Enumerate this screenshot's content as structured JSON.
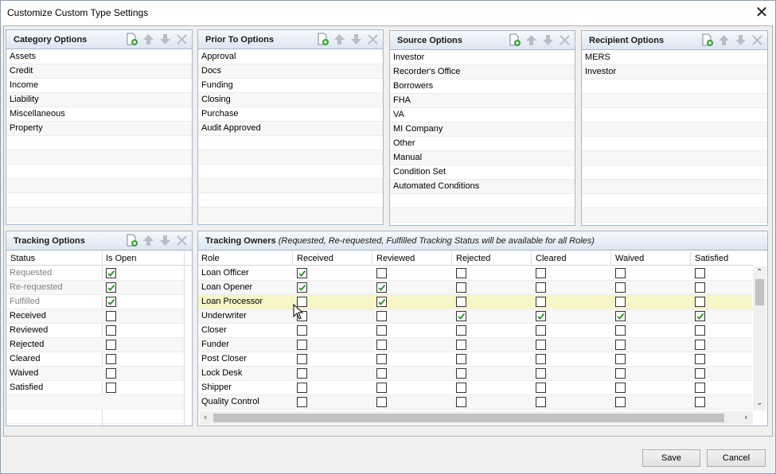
{
  "window": {
    "title": "Customize Custom Type Settings"
  },
  "category": {
    "title": "Category Options",
    "items": [
      "Assets",
      "Credit",
      "Income",
      "Liability",
      "Miscellaneous",
      "Property"
    ]
  },
  "prior_to": {
    "title": "Prior To Options",
    "items": [
      "Approval",
      "Docs",
      "Funding",
      "Closing",
      "Purchase",
      "Audit Approved"
    ]
  },
  "source": {
    "title": "Source Options",
    "items": [
      "Investor",
      "Recorder's Office",
      "Borrowers",
      "FHA",
      "VA",
      "MI Company",
      "Other",
      "Manual",
      "Condition Set",
      "Automated Conditions"
    ]
  },
  "recipient": {
    "title": "Recipient Options",
    "items": [
      "MERS",
      "Investor"
    ]
  },
  "tracking_options": {
    "title": "Tracking Options",
    "col_status": "Status",
    "col_open": "Is Open",
    "rows": [
      {
        "status": "Requested",
        "open": true,
        "muted": true
      },
      {
        "status": "Re-requested",
        "open": true,
        "muted": true
      },
      {
        "status": "Fulfilled",
        "open": true,
        "muted": true
      },
      {
        "status": "Received",
        "open": false,
        "muted": false
      },
      {
        "status": "Reviewed",
        "open": false,
        "muted": false
      },
      {
        "status": "Rejected",
        "open": false,
        "muted": false
      },
      {
        "status": "Cleared",
        "open": false,
        "muted": false
      },
      {
        "status": "Waived",
        "open": false,
        "muted": false
      },
      {
        "status": "Satisfied",
        "open": false,
        "muted": false
      }
    ]
  },
  "tracking_owners": {
    "title": "Tracking Owners",
    "subtitle": "(Requested, Re-requested, Fulfilled Tracking Status will be available for all Roles)",
    "columns": [
      "Role",
      "Received",
      "Reviewed",
      "Rejected",
      "Cleared",
      "Waived",
      "Satisfied"
    ],
    "rows": [
      {
        "role": "Loan Officer",
        "checks": [
          true,
          false,
          false,
          false,
          false,
          false
        ]
      },
      {
        "role": "Loan Opener",
        "checks": [
          true,
          true,
          false,
          false,
          false,
          false
        ]
      },
      {
        "role": "Loan Processor",
        "checks": [
          false,
          true,
          false,
          false,
          false,
          false
        ],
        "selected": true
      },
      {
        "role": "Underwriter",
        "checks": [
          false,
          false,
          true,
          true,
          true,
          true
        ]
      },
      {
        "role": "Closer",
        "checks": [
          false,
          false,
          false,
          false,
          false,
          false
        ]
      },
      {
        "role": "Funder",
        "checks": [
          false,
          false,
          false,
          false,
          false,
          false
        ]
      },
      {
        "role": "Post Closer",
        "checks": [
          false,
          false,
          false,
          false,
          false,
          false
        ]
      },
      {
        "role": "Lock Desk",
        "checks": [
          false,
          false,
          false,
          false,
          false,
          false
        ]
      },
      {
        "role": "Shipper",
        "checks": [
          false,
          false,
          false,
          false,
          false,
          false
        ]
      },
      {
        "role": "Quality Control",
        "checks": [
          false,
          false,
          false,
          false,
          false,
          false
        ]
      }
    ]
  },
  "buttons": {
    "save": "Save",
    "cancel": "Cancel"
  },
  "icons": {
    "add": "add-document-icon",
    "up": "move-up-icon",
    "down": "move-down-icon",
    "delete": "delete-icon"
  },
  "colors": {
    "check": "#2e8b2e",
    "selected_row": "#f7f6c6",
    "header": "#dbe5f1"
  }
}
